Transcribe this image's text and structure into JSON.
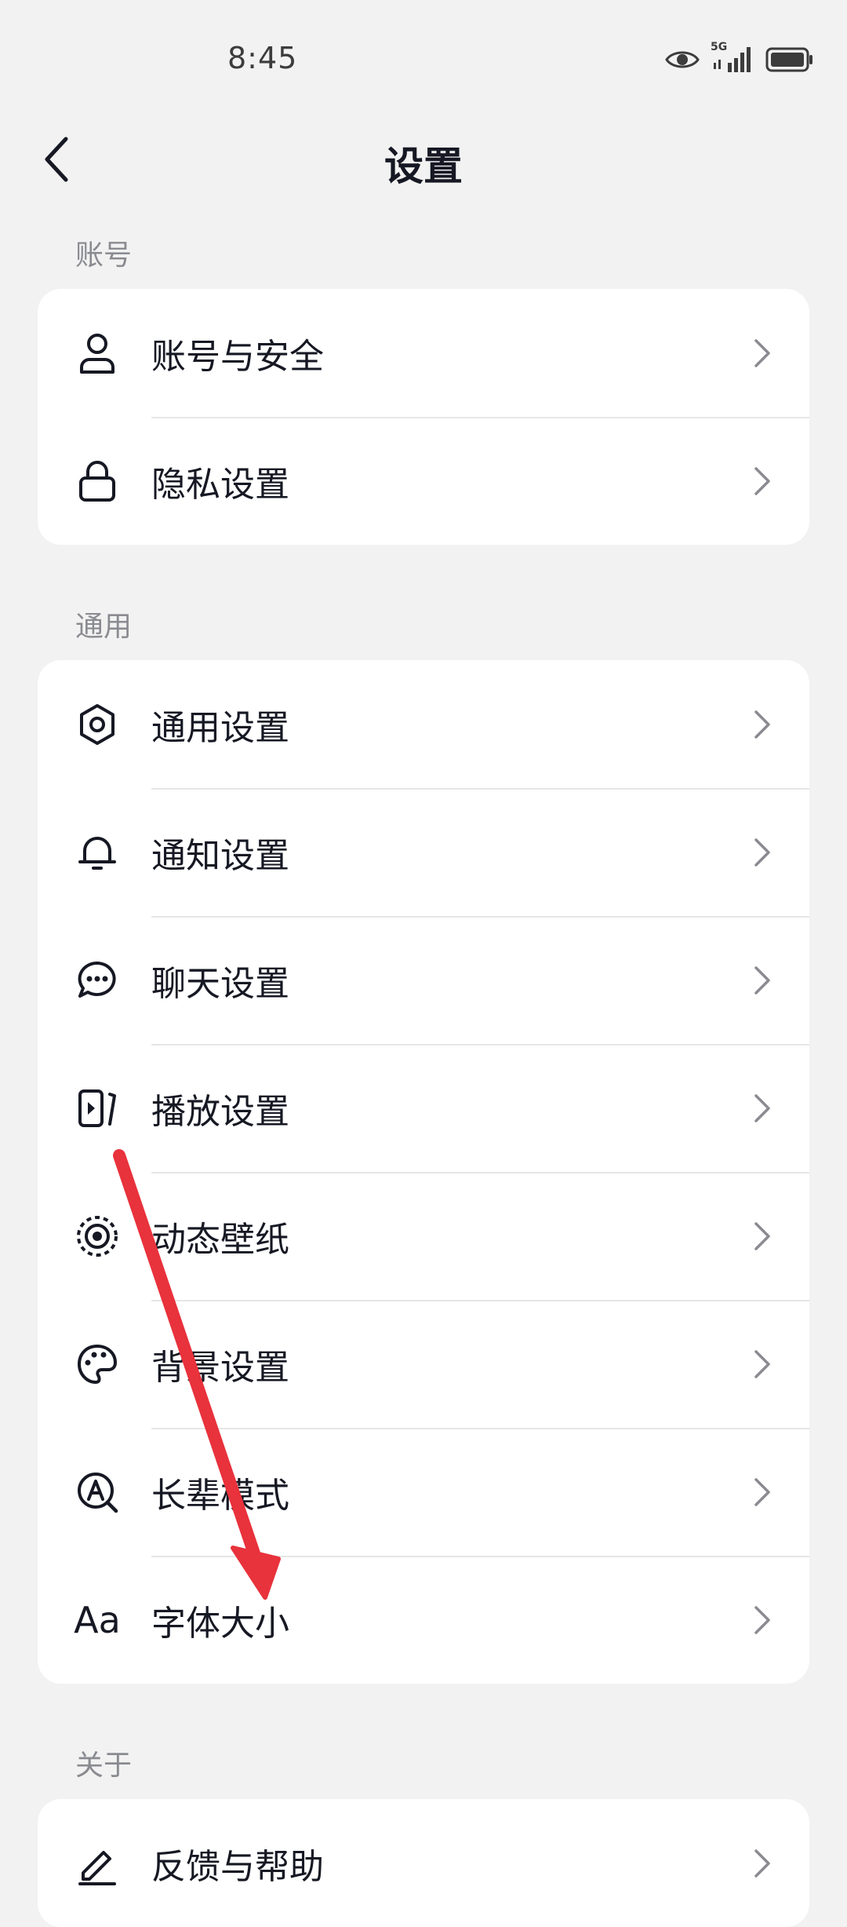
{
  "status": {
    "time": "8:45",
    "network": "5G"
  },
  "nav": {
    "title": "设置"
  },
  "sections": {
    "account": {
      "label": "账号",
      "items": [
        {
          "label": "账号与安全",
          "icon": "person-icon"
        },
        {
          "label": "隐私设置",
          "icon": "lock-icon"
        }
      ]
    },
    "general": {
      "label": "通用",
      "items": [
        {
          "label": "通用设置",
          "icon": "gear-icon"
        },
        {
          "label": "通知设置",
          "icon": "bell-icon"
        },
        {
          "label": "聊天设置",
          "icon": "chat-bubble-icon"
        },
        {
          "label": "播放设置",
          "icon": "play-icon"
        },
        {
          "label": "动态壁纸",
          "icon": "live-wallpaper-icon"
        },
        {
          "label": "背景设置",
          "icon": "palette-icon"
        },
        {
          "label": "长辈模式",
          "icon": "elder-mode-icon"
        },
        {
          "label": "字体大小",
          "icon": "font-size-icon",
          "glyph": "Aa"
        }
      ]
    },
    "about": {
      "label": "关于",
      "items": [
        {
          "label": "反馈与帮助",
          "icon": "pen-icon"
        }
      ]
    }
  },
  "colors": {
    "annotation_arrow": "#e8323c",
    "background": "#f2f2f2"
  }
}
